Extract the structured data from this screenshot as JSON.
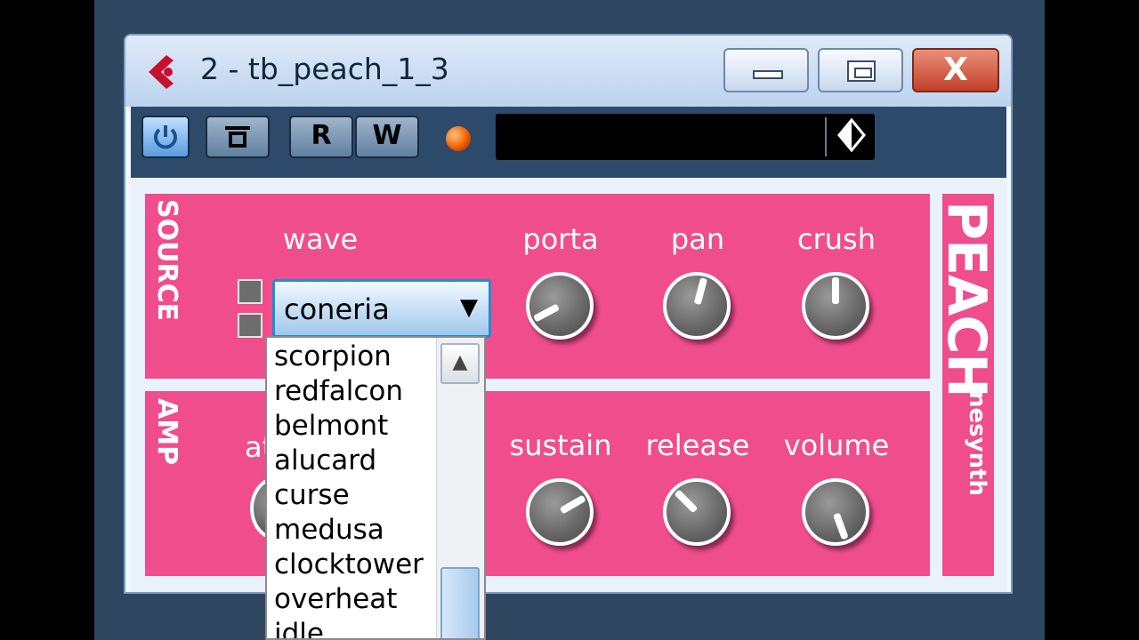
{
  "window": {
    "title": "2 - tb_peach_1_3",
    "close_glyph": "X"
  },
  "toolbar": {
    "read_label": "R",
    "write_label": "W",
    "preset_text": ""
  },
  "plugin": {
    "brand_name": "PEACH",
    "brand_sub": "nesynth",
    "source": {
      "section_label": "SOURCE",
      "wave_label": "wave",
      "wave_value": "coneria",
      "knobs": [
        {
          "label": "porta"
        },
        {
          "label": "pan"
        },
        {
          "label": "crush"
        }
      ]
    },
    "amp": {
      "section_label": "AMP",
      "attack_label_partial": "at",
      "knobs": [
        {
          "label": "sustain"
        },
        {
          "label": "release"
        },
        {
          "label": "volume"
        }
      ]
    },
    "wave_options": [
      "scorpion",
      "redfalcon",
      "belmont",
      "alucard",
      "curse",
      "medusa",
      "clocktower",
      "overheat",
      "idle"
    ]
  },
  "colors": {
    "panel_pink": "#f04d8d",
    "toolbar": "#2d4a6a",
    "desktop": "#2f4661",
    "led": "#f06000"
  },
  "icons": {
    "app": "cubase-logo-icon",
    "power": "power-icon",
    "bypass": "bypass-icon",
    "preset": "preset-diamond-icon",
    "dropdown": "chevron-down-icon",
    "scroll_up": "scroll-up-arrow-icon"
  }
}
